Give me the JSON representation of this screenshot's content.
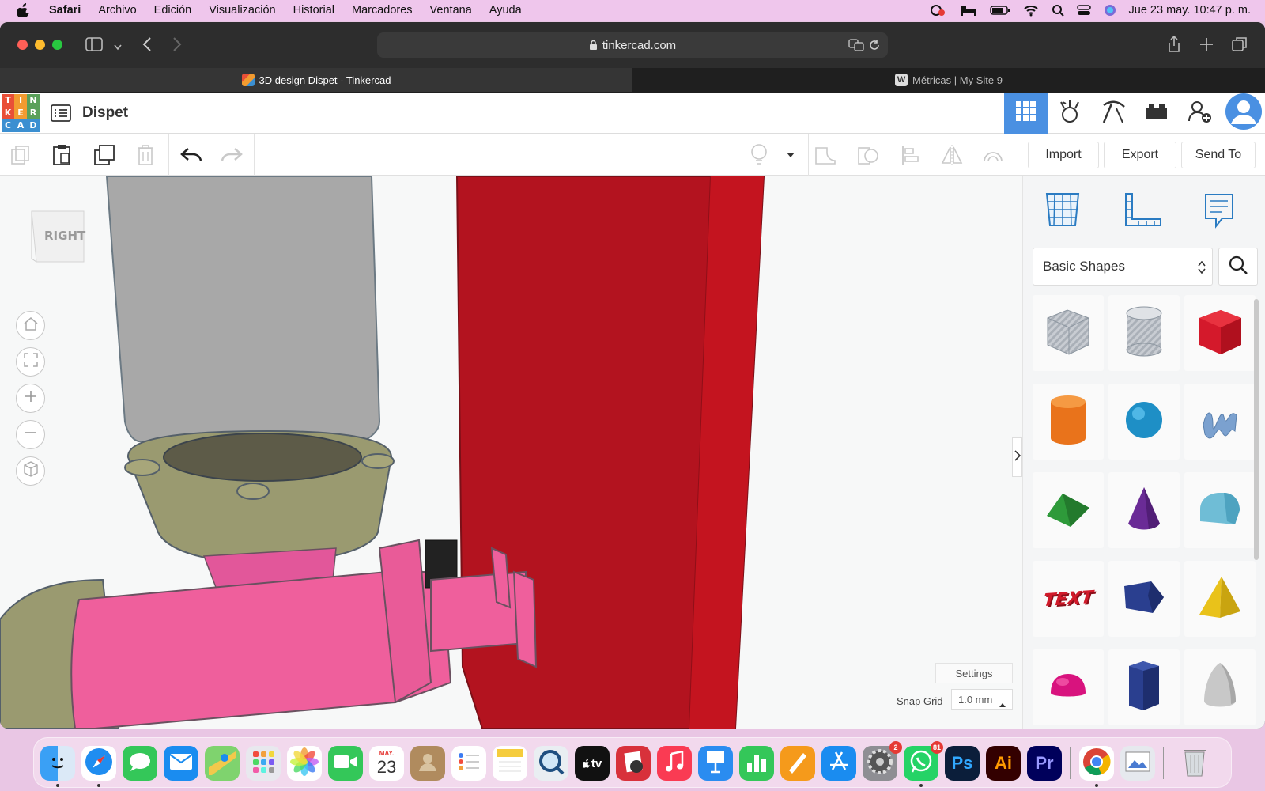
{
  "menubar": {
    "app": "Safari",
    "items": [
      "Archivo",
      "Edición",
      "Visualización",
      "Historial",
      "Marcadores",
      "Ventana",
      "Ayuda"
    ],
    "datetime": "Jue 23 may.  10:47 p. m."
  },
  "browser": {
    "url": "tinkercad.com",
    "tabs": [
      {
        "label": "3D design Dispet - Tinkercad",
        "active": true
      },
      {
        "label": "Métricas | My Site 9",
        "active": false
      }
    ]
  },
  "tinkercad": {
    "logo_letters": [
      "T",
      "I",
      "N",
      "K",
      "E",
      "R",
      "C",
      "A",
      "D"
    ],
    "logo_colors": [
      "#e94f37",
      "#f29b30",
      "#5aa05a",
      "#e94f37",
      "#f29b30",
      "#5aa05a",
      "#3b8fd1",
      "#3b8fd1",
      "#3b8fd1"
    ],
    "project_name": "Dispet",
    "toolbar": {
      "import_label": "Import",
      "export_label": "Export",
      "sendto_label": "Send To"
    },
    "viewcube_label": "RIGHT",
    "shape_library": {
      "selected": "Basic Shapes",
      "shapes": [
        {
          "name": "Box (hole)",
          "icon": "box-hole-icon"
        },
        {
          "name": "Cylinder (hole)",
          "icon": "cylinder-hole-icon"
        },
        {
          "name": "Box",
          "icon": "box-icon"
        },
        {
          "name": "Cylinder",
          "icon": "cylinder-icon"
        },
        {
          "name": "Sphere",
          "icon": "sphere-icon"
        },
        {
          "name": "Scribble",
          "icon": "scribble-icon"
        },
        {
          "name": "Roof",
          "icon": "roof-icon"
        },
        {
          "name": "Cone",
          "icon": "cone-icon"
        },
        {
          "name": "Round Roof",
          "icon": "round-roof-icon"
        },
        {
          "name": "Text",
          "icon": "text-icon",
          "text": "TEXT"
        },
        {
          "name": "Polygon",
          "icon": "polygon-icon"
        },
        {
          "name": "Pyramid",
          "icon": "pyramid-icon"
        },
        {
          "name": "Half Sphere",
          "icon": "half-sphere-icon"
        },
        {
          "name": "Hexagonal Prism",
          "icon": "hex-prism-icon"
        },
        {
          "name": "Paraboloid",
          "icon": "paraboloid-icon"
        }
      ]
    },
    "settings_label": "Settings",
    "snap_grid_label": "Snap Grid",
    "snap_grid_value": "1.0 mm",
    "colors": {
      "accent": "#4a90e2",
      "red_shape": "#b0101e",
      "pink_shape": "#ef5f9c",
      "olive_shape": "#9a9a70"
    }
  },
  "dock": {
    "apps": [
      "Finder",
      "Safari",
      "Messages",
      "Mail",
      "Maps",
      "Launchpad",
      "Photos",
      "FaceTime",
      "Calendar",
      "Contacts",
      "Reminders",
      "Notes",
      "QuickTime",
      "TV",
      "Photo Booth",
      "Music",
      "Keynote",
      "Numbers",
      "Pages",
      "App Store",
      "System Settings",
      "WhatsApp",
      "Photoshop",
      "Illustrator",
      "Premiere Pro",
      "Chrome",
      "Preview",
      "Trash"
    ],
    "calendar_month": "MAY.",
    "calendar_day": "23",
    "tv_label": "tv",
    "ps_label": "Ps",
    "ai_label": "Ai",
    "pr_label": "Pr",
    "badge_settings": "2",
    "badge_whatsapp": "81"
  }
}
